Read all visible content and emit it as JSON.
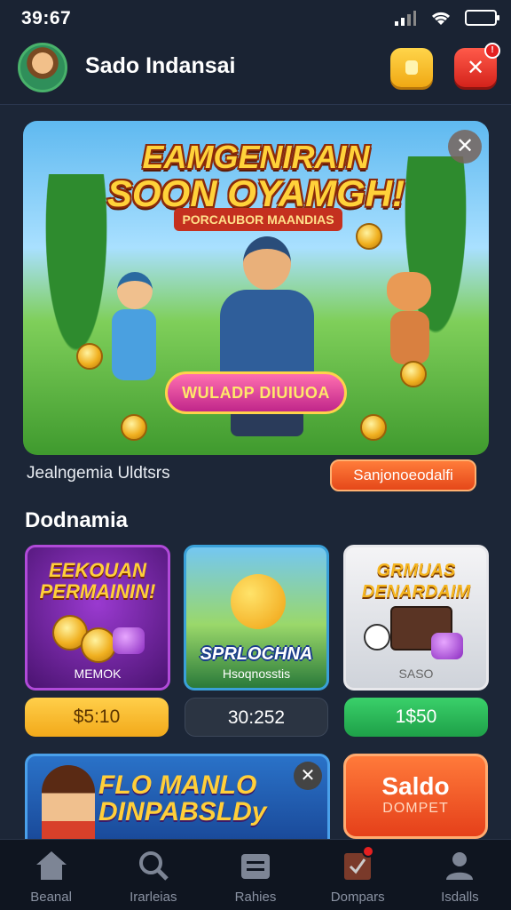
{
  "status_bar": {
    "time": "39:67",
    "battery": ""
  },
  "header": {
    "title": "Sado Indansai",
    "notification_badge": "!"
  },
  "banner": {
    "title_line1": "EAMGENIRAIN",
    "title_line2": "SOON OYAMGH!",
    "subtitle": "PORCAUBOR MAANDIAS",
    "cta": "WULADP DIUIUOA",
    "close": "✕"
  },
  "promo_row": {
    "caption": "Jealngemia Uldtsrs",
    "button": "Sanjonoeodalfi"
  },
  "section": {
    "title": "Dodnamia"
  },
  "games": [
    {
      "title": "EEKOUAN PERMAININ!",
      "subtitle": "MEMOK",
      "price": "$5:10"
    },
    {
      "title": "SPRLOCHNA",
      "subtitle": "Hsoqnosstis",
      "price": "30:252"
    },
    {
      "title": "GRMUAS DENARDAIM",
      "subtitle": "SASO",
      "price": "1$50"
    }
  ],
  "promo": {
    "title_line1": "FLO MANLO",
    "title_line2": "DINPABSLDy",
    "close": "✕"
  },
  "saldo": {
    "label": "Saldo",
    "sublabel": "DOMPET"
  },
  "bottom_nav": [
    {
      "label": "Beanal",
      "icon": "home-icon"
    },
    {
      "label": "Irarleias",
      "icon": "search-icon"
    },
    {
      "label": "Rahies",
      "icon": "list-icon"
    },
    {
      "label": "Dompars",
      "icon": "wallet-icon"
    },
    {
      "label": "Isdalls",
      "icon": "profile-icon"
    }
  ],
  "colors": {
    "background": "#1c2637",
    "accent_orange": "#e5481a",
    "accent_yellow": "#f2a91a",
    "accent_green": "#1ea048"
  }
}
